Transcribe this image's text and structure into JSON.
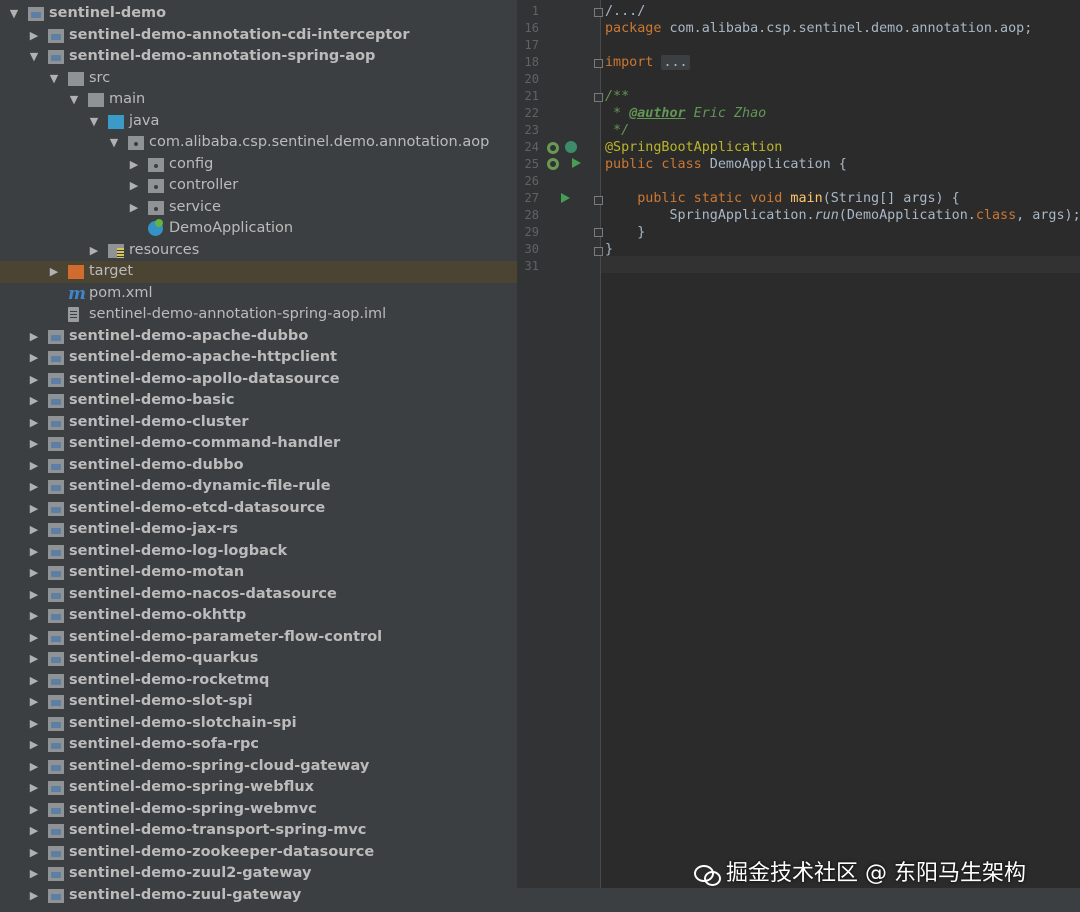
{
  "project_tree": {
    "items": [
      {
        "label": "sentinel-demo",
        "depth": 0,
        "arrow": "down",
        "icon": "module-folder-icon",
        "bold": true
      },
      {
        "label": "sentinel-demo-annotation-cdi-interceptor",
        "depth": 1,
        "arrow": "right",
        "icon": "module-folder-icon",
        "bold": true
      },
      {
        "label": "sentinel-demo-annotation-spring-aop",
        "depth": 1,
        "arrow": "down",
        "icon": "module-folder-icon",
        "bold": true
      },
      {
        "label": "src",
        "depth": 2,
        "arrow": "down",
        "icon": "folder-icon"
      },
      {
        "label": "main",
        "depth": 3,
        "arrow": "down",
        "icon": "folder-icon"
      },
      {
        "label": "java",
        "depth": 4,
        "arrow": "down",
        "icon": "source-folder-icon"
      },
      {
        "label": "com.alibaba.csp.sentinel.demo.annotation.aop",
        "depth": 5,
        "arrow": "down",
        "icon": "package-icon"
      },
      {
        "label": "config",
        "depth": 6,
        "arrow": "right",
        "icon": "package-icon"
      },
      {
        "label": "controller",
        "depth": 6,
        "arrow": "right",
        "icon": "package-icon"
      },
      {
        "label": "service",
        "depth": 6,
        "arrow": "right",
        "icon": "package-icon"
      },
      {
        "label": "DemoApplication",
        "depth": 6,
        "arrow": "",
        "icon": "spring-boot-class-icon"
      },
      {
        "label": "resources",
        "depth": 4,
        "arrow": "right",
        "icon": "resources-folder-icon"
      },
      {
        "label": "target",
        "depth": 2,
        "arrow": "right",
        "icon": "excluded-folder-icon",
        "selected": true
      },
      {
        "label": "pom.xml",
        "depth": 2,
        "arrow": "",
        "icon": "maven-icon"
      },
      {
        "label": "sentinel-demo-annotation-spring-aop.iml",
        "depth": 2,
        "arrow": "",
        "icon": "iml-file-icon"
      },
      {
        "label": "sentinel-demo-apache-dubbo",
        "depth": 1,
        "arrow": "right",
        "icon": "module-folder-icon",
        "bold": true
      },
      {
        "label": "sentinel-demo-apache-httpclient",
        "depth": 1,
        "arrow": "right",
        "icon": "module-folder-icon",
        "bold": true
      },
      {
        "label": "sentinel-demo-apollo-datasource",
        "depth": 1,
        "arrow": "right",
        "icon": "module-folder-icon",
        "bold": true
      },
      {
        "label": "sentinel-demo-basic",
        "depth": 1,
        "arrow": "right",
        "icon": "module-folder-icon",
        "bold": true
      },
      {
        "label": "sentinel-demo-cluster",
        "depth": 1,
        "arrow": "right",
        "icon": "module-folder-icon",
        "bold": true
      },
      {
        "label": "sentinel-demo-command-handler",
        "depth": 1,
        "arrow": "right",
        "icon": "module-folder-icon",
        "bold": true
      },
      {
        "label": "sentinel-demo-dubbo",
        "depth": 1,
        "arrow": "right",
        "icon": "module-folder-icon",
        "bold": true
      },
      {
        "label": "sentinel-demo-dynamic-file-rule",
        "depth": 1,
        "arrow": "right",
        "icon": "module-folder-icon",
        "bold": true
      },
      {
        "label": "sentinel-demo-etcd-datasource",
        "depth": 1,
        "arrow": "right",
        "icon": "module-folder-icon",
        "bold": true
      },
      {
        "label": "sentinel-demo-jax-rs",
        "depth": 1,
        "arrow": "right",
        "icon": "module-folder-icon",
        "bold": true
      },
      {
        "label": "sentinel-demo-log-logback",
        "depth": 1,
        "arrow": "right",
        "icon": "module-folder-icon",
        "bold": true
      },
      {
        "label": "sentinel-demo-motan",
        "depth": 1,
        "arrow": "right",
        "icon": "module-folder-icon",
        "bold": true
      },
      {
        "label": "sentinel-demo-nacos-datasource",
        "depth": 1,
        "arrow": "right",
        "icon": "module-folder-icon",
        "bold": true
      },
      {
        "label": "sentinel-demo-okhttp",
        "depth": 1,
        "arrow": "right",
        "icon": "module-folder-icon",
        "bold": true
      },
      {
        "label": "sentinel-demo-parameter-flow-control",
        "depth": 1,
        "arrow": "right",
        "icon": "module-folder-icon",
        "bold": true
      },
      {
        "label": "sentinel-demo-quarkus",
        "depth": 1,
        "arrow": "right",
        "icon": "module-folder-icon",
        "bold": true
      },
      {
        "label": "sentinel-demo-rocketmq",
        "depth": 1,
        "arrow": "right",
        "icon": "module-folder-icon",
        "bold": true
      },
      {
        "label": "sentinel-demo-slot-spi",
        "depth": 1,
        "arrow": "right",
        "icon": "module-folder-icon",
        "bold": true
      },
      {
        "label": "sentinel-demo-slotchain-spi",
        "depth": 1,
        "arrow": "right",
        "icon": "module-folder-icon",
        "bold": true
      },
      {
        "label": "sentinel-demo-sofa-rpc",
        "depth": 1,
        "arrow": "right",
        "icon": "module-folder-icon",
        "bold": true
      },
      {
        "label": "sentinel-demo-spring-cloud-gateway",
        "depth": 1,
        "arrow": "right",
        "icon": "module-folder-icon",
        "bold": true
      },
      {
        "label": "sentinel-demo-spring-webflux",
        "depth": 1,
        "arrow": "right",
        "icon": "module-folder-icon",
        "bold": true
      },
      {
        "label": "sentinel-demo-spring-webmvc",
        "depth": 1,
        "arrow": "right",
        "icon": "module-folder-icon",
        "bold": true
      },
      {
        "label": "sentinel-demo-transport-spring-mvc",
        "depth": 1,
        "arrow": "right",
        "icon": "module-folder-icon",
        "bold": true
      },
      {
        "label": "sentinel-demo-zookeeper-datasource",
        "depth": 1,
        "arrow": "right",
        "icon": "module-folder-icon",
        "bold": true
      },
      {
        "label": "sentinel-demo-zuul2-gateway",
        "depth": 1,
        "arrow": "right",
        "icon": "module-folder-icon",
        "bold": true
      },
      {
        "label": "sentinel-demo-zuul-gateway",
        "depth": 1,
        "arrow": "right",
        "icon": "module-folder-icon",
        "bold": true
      }
    ]
  },
  "editor": {
    "line_numbers": [
      "1",
      "16",
      "17",
      "18",
      "20",
      "21",
      "22",
      "23",
      "24",
      "25",
      "26",
      "27",
      "28",
      "29",
      "30",
      "31"
    ],
    "code": {
      "l1": "/.../",
      "pkg_kw": "package",
      "pkg_name": " com.alibaba.csp.sentinel.demo.annotation.aop;",
      "import_kw": "import",
      "import_collapsed": "...",
      "doc_open": "/**",
      "doc_star": " * ",
      "doc_tag": "@author",
      "doc_author": " Eric Zhao",
      "doc_close": " */",
      "annotation": "@SpringBootApplication",
      "class_kw": "public class",
      "class_name": " DemoApplication {",
      "method_kw": "    public static void",
      "method_name": " main",
      "method_sig": "(String[] args) {",
      "call_prefix": "        SpringApplication.",
      "call_method": "run",
      "call_args_a": "(DemoApplication.",
      "call_class_kw": "class",
      "call_args_b": ", args);",
      "close_method": "    }",
      "close_class": "}"
    },
    "colors": {
      "keyword": "#cc7832",
      "annotation": "#bbb529",
      "doc": "#629755",
      "method": "#ffc66d",
      "text": "#a9b7c6"
    }
  },
  "watermark": {
    "text": "掘金技术社区 @ 东阳马生架构"
  }
}
